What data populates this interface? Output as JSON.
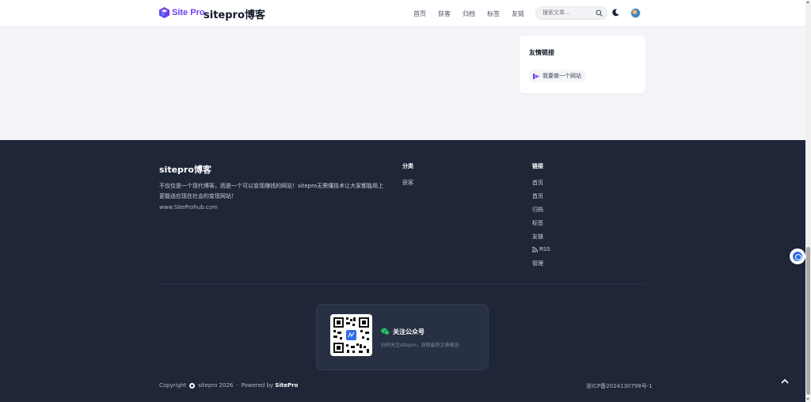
{
  "header": {
    "logo_text": "Site Pro",
    "brand": "sitepro博客",
    "nav": [
      "首页",
      "获客",
      "归档",
      "标签",
      "友链"
    ],
    "search_placeholder": "搜索文章...",
    "accent": "#6d3df0"
  },
  "sidebar_card": {
    "title": "友情链接",
    "link_label": "我要做一个网站"
  },
  "footer": {
    "title": "sitepro博客",
    "description": "不仅仅是一个现代博客，而是一个可以变现赚钱的网站！sitepro无需懂技术让大家都能用上更能适应现在社会的变现网站！",
    "url": "www.SiteProhub.com",
    "categories_heading": "分类",
    "categories": [
      "获客"
    ],
    "links_heading": "链接",
    "links": [
      "首页",
      "首页",
      "归档",
      "标签",
      "友链",
      "RSS",
      "管理"
    ],
    "qr_title": "关注公众号",
    "qr_subtitle": "扫码关注sitepro，获取最新文章推送",
    "copyright_prefix": "Copyright",
    "copyright_site": "sitepro 2026",
    "separator": "·",
    "powered_by": "Powered by",
    "powered_brand": "SitePro",
    "icp": "浙ICP备2024130798号-1",
    "background": "#1e2638"
  }
}
